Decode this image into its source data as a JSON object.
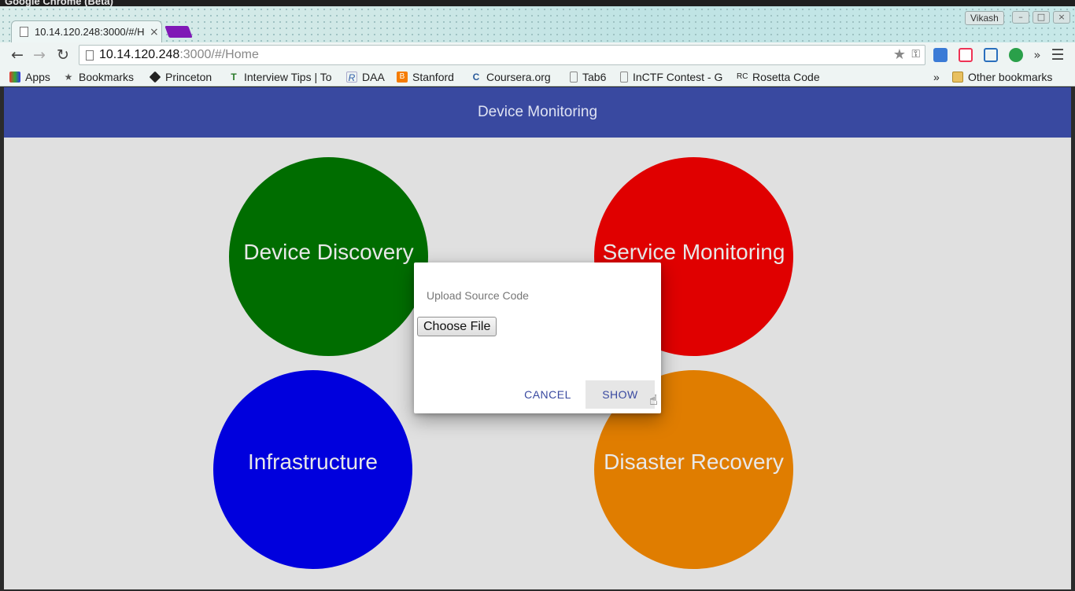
{
  "os": {
    "window_title": "Google Chrome (Beta)"
  },
  "browser": {
    "tab_title": "10.14.120.248:3000/#/Home",
    "profile": "Vikash",
    "url_host": "10.14.120.248",
    "url_rest": ":3000/#/Home",
    "bookmarks": [
      {
        "label": "Apps",
        "icon": "apps-grid-icon"
      },
      {
        "label": "Bookmarks",
        "icon": "star-icon"
      },
      {
        "label": "Princeton",
        "icon": "princeton-icon"
      },
      {
        "label": "Interview Tips | To",
        "icon": "t-icon"
      },
      {
        "label": "DAA",
        "icon": "r-icon"
      },
      {
        "label": "Stanford",
        "icon": "blogger-icon"
      },
      {
        "label": "Coursera.org",
        "icon": "coursera-icon"
      },
      {
        "label": "Tab6",
        "icon": "page-icon"
      },
      {
        "label": "InCTF Contest - G",
        "icon": "page-icon"
      },
      {
        "label": "Rosetta Code",
        "icon": "rc-icon"
      }
    ],
    "overflow": "»",
    "other_bookmarks": "Other bookmarks"
  },
  "app": {
    "header_title": "Device Monitoring",
    "tiles": [
      {
        "label": "Device Discovery",
        "color": "#006d00"
      },
      {
        "label": "Service Monitoring",
        "color": "#e00000"
      },
      {
        "label": "Infrastructure",
        "color": "#0000dd"
      },
      {
        "label": "Disaster Recovery",
        "color": "#e07d00"
      }
    ]
  },
  "dialog": {
    "title": "Upload Source Code",
    "file_button": "Choose File",
    "cancel": "CANCEL",
    "show": "SHOW"
  }
}
